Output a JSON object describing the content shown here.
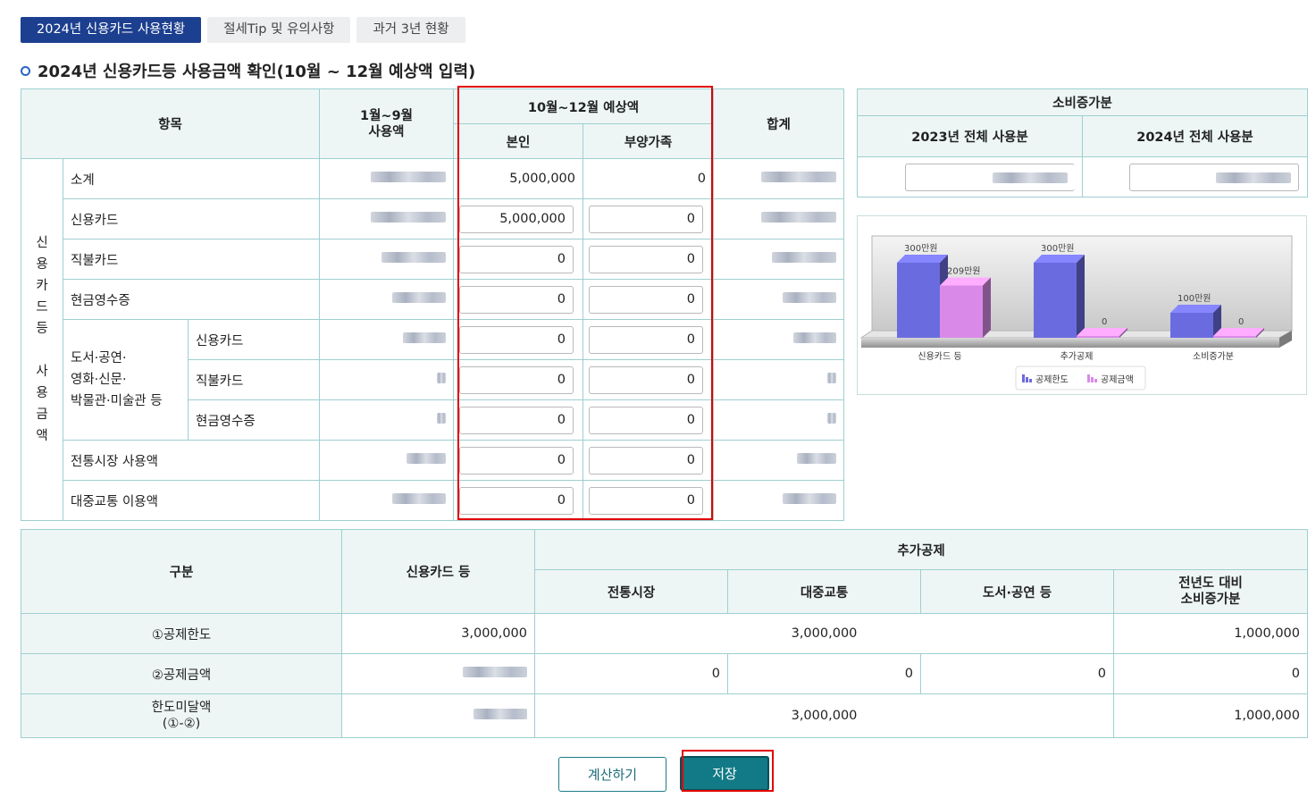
{
  "tabs": [
    "2024년 신용카드 사용현황",
    "절세Tip 및 유의사항",
    "과거 3년 현황"
  ],
  "section_title": "2024년 신용카드등 사용금액 확인(10월 ~ 12월 예상액 입력)",
  "main_table": {
    "headers": {
      "item": "항목",
      "jan_sep": "1월~9월\n사용액",
      "oct_dec": "10월~12월 예상액",
      "self": "본인",
      "dependents": "부양가족",
      "total": "합계"
    },
    "vertical_label": "신용카드등사용금액",
    "culture_group_label": "도서·공연·\n영화·신문·\n박물관·미술관 등",
    "rows": {
      "subtotal": {
        "label": "소계",
        "self": "5,000,000",
        "dependents": "0"
      },
      "credit": {
        "label": "신용카드",
        "self": "5,000,000",
        "dependents": "0"
      },
      "debit": {
        "label": "직불카드",
        "self": "0",
        "dependents": "0"
      },
      "cash": {
        "label": "현금영수증",
        "self": "0",
        "dependents": "0"
      },
      "culture_credit": {
        "label": "신용카드",
        "self": "0",
        "dependents": "0"
      },
      "culture_debit": {
        "label": "직불카드",
        "self": "0",
        "dependents": "0"
      },
      "culture_cash": {
        "label": "현금영수증",
        "self": "0",
        "dependents": "0"
      },
      "market": {
        "label": "전통시장 사용액",
        "self": "0",
        "dependents": "0"
      },
      "transit": {
        "label": "대중교통 이용액",
        "self": "0",
        "dependents": "0"
      }
    }
  },
  "spend_table": {
    "title": "소비증가분",
    "col_2023": "2023년 전체 사용분",
    "col_2024": "2024년 전체 사용분"
  },
  "chart_data": {
    "type": "bar",
    "categories": [
      "신용카드 등",
      "추가공제",
      "소비증가분"
    ],
    "series": [
      {
        "name": "공제한도",
        "values": [
          300,
          300,
          100
        ],
        "labels": [
          "300만원",
          "300만원",
          "100만원"
        ],
        "color": "#6b6be0"
      },
      {
        "name": "공제금액",
        "values": [
          209,
          0,
          0
        ],
        "labels": [
          "209만원",
          "0",
          "0"
        ],
        "color": "#d98ae8"
      }
    ],
    "ylim": [
      0,
      300
    ]
  },
  "calc_table": {
    "headers": {
      "category": "구분",
      "credit_card_etc": "신용카드 등",
      "additional": "추가공제",
      "market": "전통시장",
      "transit": "대중교통",
      "books": "도서·공연 등",
      "increase": "전년도 대비\n소비증가분"
    },
    "rows": {
      "limit": {
        "label": "①공제한도",
        "credit": "3,000,000",
        "additional": "3,000,000",
        "increase": "1,000,000"
      },
      "amount": {
        "label": "②공제금액",
        "market": "0",
        "transit": "0",
        "books": "0",
        "increase": "0"
      },
      "remaining": {
        "label": "한도미달액\n(①-②)",
        "additional": "3,000,000",
        "increase": "1,000,000"
      }
    }
  },
  "buttons": {
    "calc": "계산하기",
    "save": "저장"
  }
}
